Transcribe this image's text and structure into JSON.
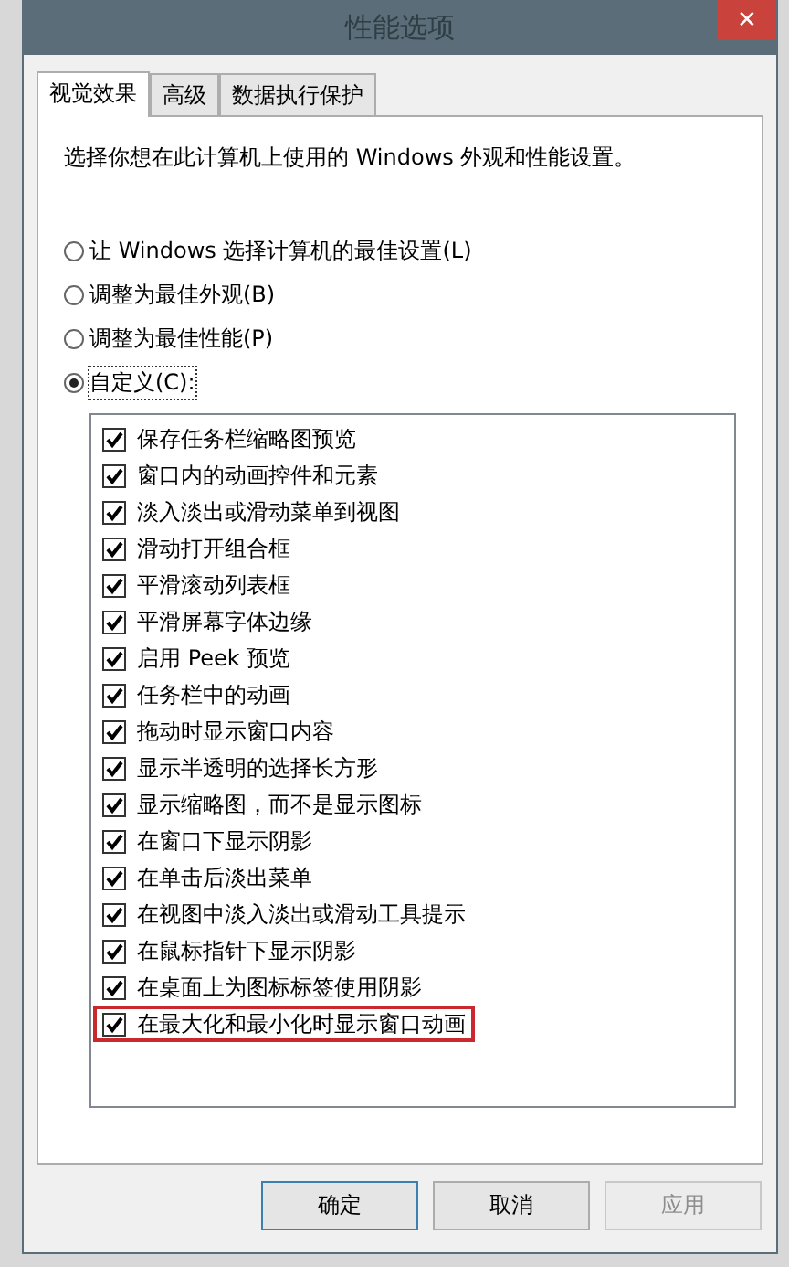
{
  "window": {
    "title": "性能选项",
    "close": "✕"
  },
  "tabs": [
    {
      "label": "视觉效果",
      "selected": true
    },
    {
      "label": "高级",
      "selected": false
    },
    {
      "label": "数据执行保护",
      "selected": false
    }
  ],
  "description": "选择你想在此计算机上使用的 Windows 外观和性能设置。",
  "options": [
    {
      "label": "让 Windows 选择计算机的最佳设置(L)",
      "selected": false
    },
    {
      "label": "调整为最佳外观(B)",
      "selected": false
    },
    {
      "label": "调整为最佳性能(P)",
      "selected": false
    },
    {
      "label": "自定义(C):",
      "selected": true
    }
  ],
  "effects": [
    {
      "label": "保存任务栏缩略图预览",
      "checked": true,
      "highlighted": false
    },
    {
      "label": "窗口内的动画控件和元素",
      "checked": true,
      "highlighted": false
    },
    {
      "label": "淡入淡出或滑动菜单到视图",
      "checked": true,
      "highlighted": false
    },
    {
      "label": "滑动打开组合框",
      "checked": true,
      "highlighted": false
    },
    {
      "label": "平滑滚动列表框",
      "checked": true,
      "highlighted": false
    },
    {
      "label": "平滑屏幕字体边缘",
      "checked": true,
      "highlighted": false
    },
    {
      "label": "启用 Peek 预览",
      "checked": true,
      "highlighted": false
    },
    {
      "label": "任务栏中的动画",
      "checked": true,
      "highlighted": false
    },
    {
      "label": "拖动时显示窗口内容",
      "checked": true,
      "highlighted": false
    },
    {
      "label": "显示半透明的选择长方形",
      "checked": true,
      "highlighted": false
    },
    {
      "label": "显示缩略图，而不是显示图标",
      "checked": true,
      "highlighted": false
    },
    {
      "label": "在窗口下显示阴影",
      "checked": true,
      "highlighted": false
    },
    {
      "label": "在单击后淡出菜单",
      "checked": true,
      "highlighted": false
    },
    {
      "label": "在视图中淡入淡出或滑动工具提示",
      "checked": true,
      "highlighted": false
    },
    {
      "label": "在鼠标指针下显示阴影",
      "checked": true,
      "highlighted": false
    },
    {
      "label": "在桌面上为图标标签使用阴影",
      "checked": true,
      "highlighted": false
    },
    {
      "label": "在最大化和最小化时显示窗口动画",
      "checked": true,
      "highlighted": true
    }
  ],
  "buttons": [
    {
      "label": "确定",
      "disabled": false,
      "default": true
    },
    {
      "label": "取消",
      "disabled": false,
      "default": false
    },
    {
      "label": "应用",
      "disabled": true,
      "default": false
    }
  ]
}
